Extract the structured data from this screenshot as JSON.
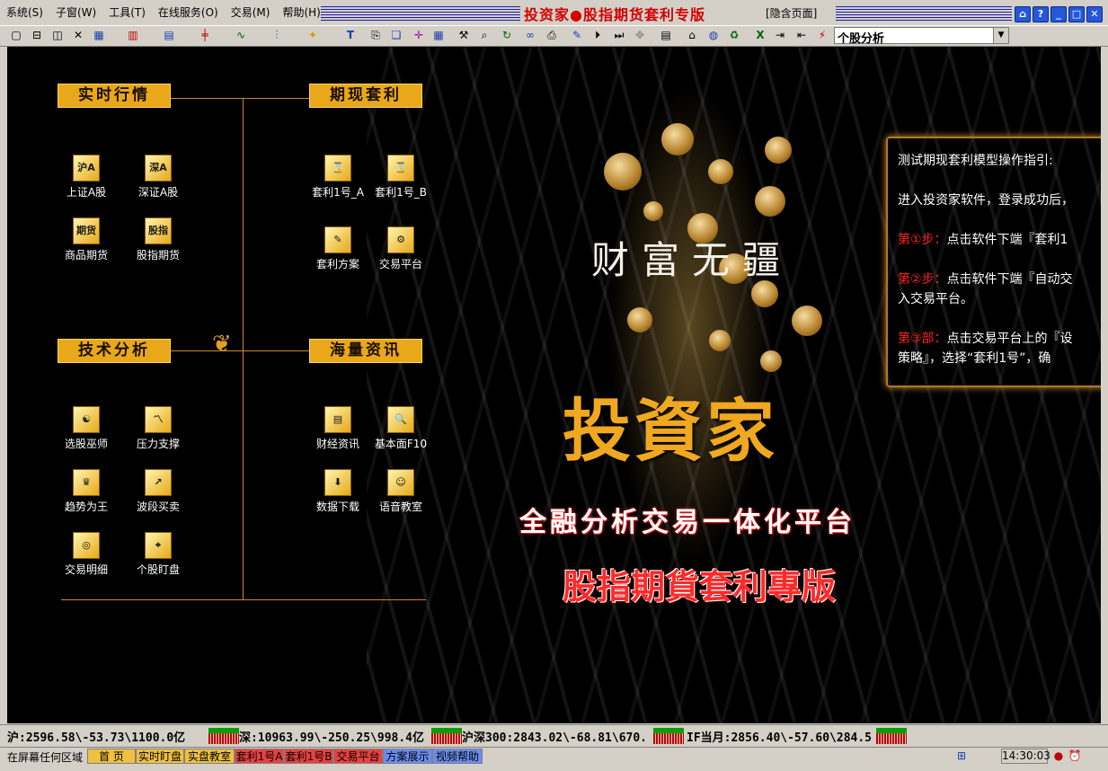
{
  "menu": [
    "系统(S)",
    "子窗(W)",
    "工具(T)",
    "在线服务(O)",
    "交易(M)",
    "帮助(H)"
  ],
  "title": "投资家●股指期货套利专版",
  "hide_page": "[隐含页面]",
  "window_buttons": [
    "home-icon",
    "help-icon",
    "minimize-icon",
    "maximize-icon",
    "close-icon"
  ],
  "toolbar": {
    "icons": [
      "new-icon",
      "window-icon",
      "split-icon",
      "close-x-icon",
      "grid-icon",
      "bar-chart-icon",
      "table-icon",
      "kline-icon",
      "line-icon",
      "volume-icon",
      "indicator-icon",
      "text-icon",
      "copy-icon",
      "layers-icon",
      "cross-icon",
      "grid2-icon",
      "tool-icon",
      "search-icon",
      "refresh-icon",
      "glasses-icon",
      "print-icon",
      "pen-icon",
      "play-icon",
      "next-icon",
      "move-icon",
      "list-icon",
      "home-icon",
      "globe-icon",
      "recycle-icon",
      "excel-icon",
      "export-icon",
      "import-icon",
      "flash-icon"
    ],
    "combo_value": "个股分析"
  },
  "sections": {
    "realtime": "实时行情",
    "arbitrage": "期现套利",
    "technical": "技术分析",
    "news": "海量资讯"
  },
  "icons_realtime": [
    {
      "label": "上证A股",
      "glyph": "沪A"
    },
    {
      "label": "深证A股",
      "glyph": "深A"
    },
    {
      "label": "商品期货",
      "glyph": "期货"
    },
    {
      "label": "股指期货",
      "glyph": "股指"
    }
  ],
  "icons_arbitrage": [
    {
      "label": "套利1号_A",
      "glyph": "⌛"
    },
    {
      "label": "套利1号_B",
      "glyph": "⌛"
    },
    {
      "label": "套利方案",
      "glyph": "✎"
    },
    {
      "label": "交易平台",
      "glyph": "⚙"
    }
  ],
  "icons_technical": [
    {
      "label": "选股巫师",
      "glyph": "☯"
    },
    {
      "label": "压力支撑",
      "glyph": "〽"
    },
    {
      "label": "趋势为王",
      "glyph": "♛"
    },
    {
      "label": "波段买卖",
      "glyph": "↗"
    },
    {
      "label": "交易明细",
      "glyph": "◎"
    },
    {
      "label": "个股盯盘",
      "glyph": "⌖"
    }
  ],
  "icons_news": [
    {
      "label": "财经资讯",
      "glyph": "▤"
    },
    {
      "label": "基本面F10",
      "glyph": "🔍"
    },
    {
      "label": "数据下载",
      "glyph": "⬇"
    },
    {
      "label": "语音教室",
      "glyph": "☺"
    }
  ],
  "banner": {
    "slogan": "财富无疆",
    "brand": "投資家",
    "subtitle": "全融分析交易一体化平台",
    "edition": "股指期貨套利專版"
  },
  "guide": {
    "title": "测试期现套利模型操作指引:",
    "intro": "进入投资家软件，登录成功后，",
    "step1_label": "第①步：",
    "step1_text": "点击软件下端『套利1",
    "step2_label": "第②步：",
    "step2_text": "点击软件下端『自动交",
    "step2_cont": "入交易平台。",
    "step3_label": "第③部：",
    "step3_text": "点击交易平台上的『设",
    "step3_cont": "策略』，选择“套利1号”，确"
  },
  "ticker": {
    "sh": "沪:2596.58\\-53.73\\1100.0亿",
    "sz": "深:10963.99\\-250.25\\998.4亿",
    "hs300": "沪深300:2843.02\\-68.81\\670.",
    "if": "IF当月:2856.40\\-57.60\\284.5"
  },
  "status": {
    "hint": "在屏幕任何区域",
    "tabs": [
      "首 页",
      "实时盯盘",
      "实盘教室",
      "套利1号A",
      "套利1号B",
      "交易平台",
      "方案展示",
      "视频帮助"
    ],
    "time": "14:30:03"
  }
}
